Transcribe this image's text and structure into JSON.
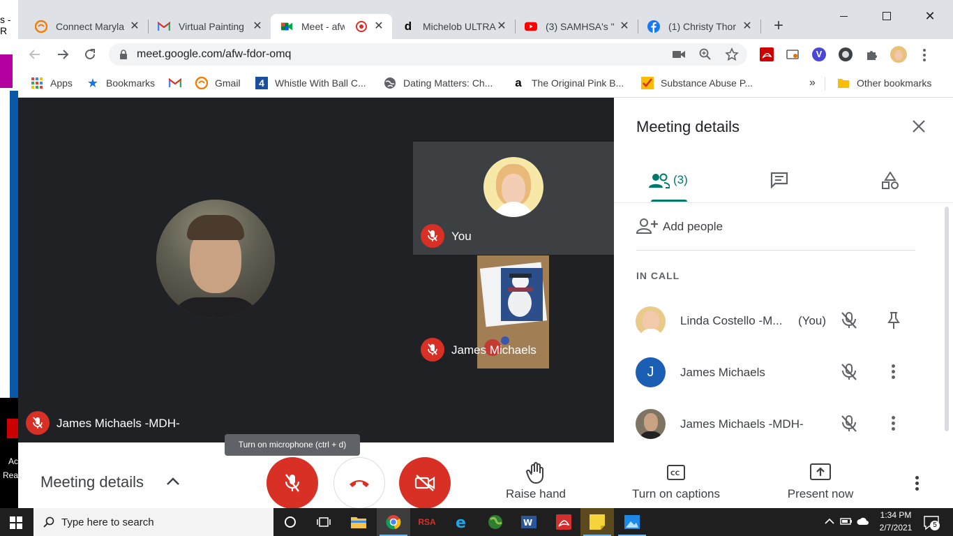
{
  "browser": {
    "tabs": [
      {
        "title": "Connect Maryla",
        "favicon": "swirl-orange-icon"
      },
      {
        "title": "Virtual Painting",
        "favicon": "gmail-icon"
      },
      {
        "title": "Meet - afw",
        "favicon": "google-meet-icon",
        "active": true
      },
      {
        "title": "Michelob ULTRA",
        "favicon": "letter-d-icon"
      },
      {
        "title": "(3) SAMHSA's \"",
        "favicon": "youtube-icon"
      },
      {
        "title": "(1) Christy Thor",
        "favicon": "facebook-icon"
      }
    ],
    "url": "meet.google.com/afw-fdor-omq",
    "bookmarks": [
      {
        "label": "Apps",
        "icon": "apps-grid-icon"
      },
      {
        "label": "Bookmarks",
        "icon": "star-icon"
      },
      {
        "label": "",
        "icon": "gmail-icon"
      },
      {
        "label": "Gmail",
        "icon": "swirl-orange-icon"
      },
      {
        "label": "Whistle With Ball C...",
        "icon": "channel-4-icon"
      },
      {
        "label": "Dating Matters: Ch...",
        "icon": "globe-icon"
      },
      {
        "label": "The Original Pink B...",
        "icon": "amazon-icon"
      },
      {
        "label": "Substance Abuse P...",
        "icon": "check-badge-icon"
      }
    ],
    "more_bookmarks": "»",
    "other_bookmarks": "Other bookmarks"
  },
  "meet": {
    "main_tile_name": "James Michaels -MDH-",
    "tile_you": "You",
    "tile_james": "James Michaels",
    "tooltip": "Turn on microphone (ctrl + d)",
    "panel": {
      "title": "Meeting details",
      "people_count": "(3)",
      "add_people": "Add people",
      "section": "IN CALL",
      "participants": [
        {
          "name": "Linda Costello -M...",
          "suffix": "(You)"
        },
        {
          "name": "James Michaels",
          "initial": "J"
        },
        {
          "name": "James Michaels -MDH-"
        }
      ]
    },
    "controls": {
      "meeting_details": "Meeting details",
      "raise_hand": "Raise hand",
      "captions": "Turn on captions",
      "present": "Present now"
    }
  },
  "taskbar": {
    "search_placeholder": "Type here to search",
    "time": "1:34 PM",
    "date": "2/7/2021",
    "notifications": "5"
  },
  "colors": {
    "meet_red": "#d93025",
    "stage_bg": "#202124",
    "accent_teal": "#00796b",
    "chrome_frame": "#dee1e6"
  }
}
